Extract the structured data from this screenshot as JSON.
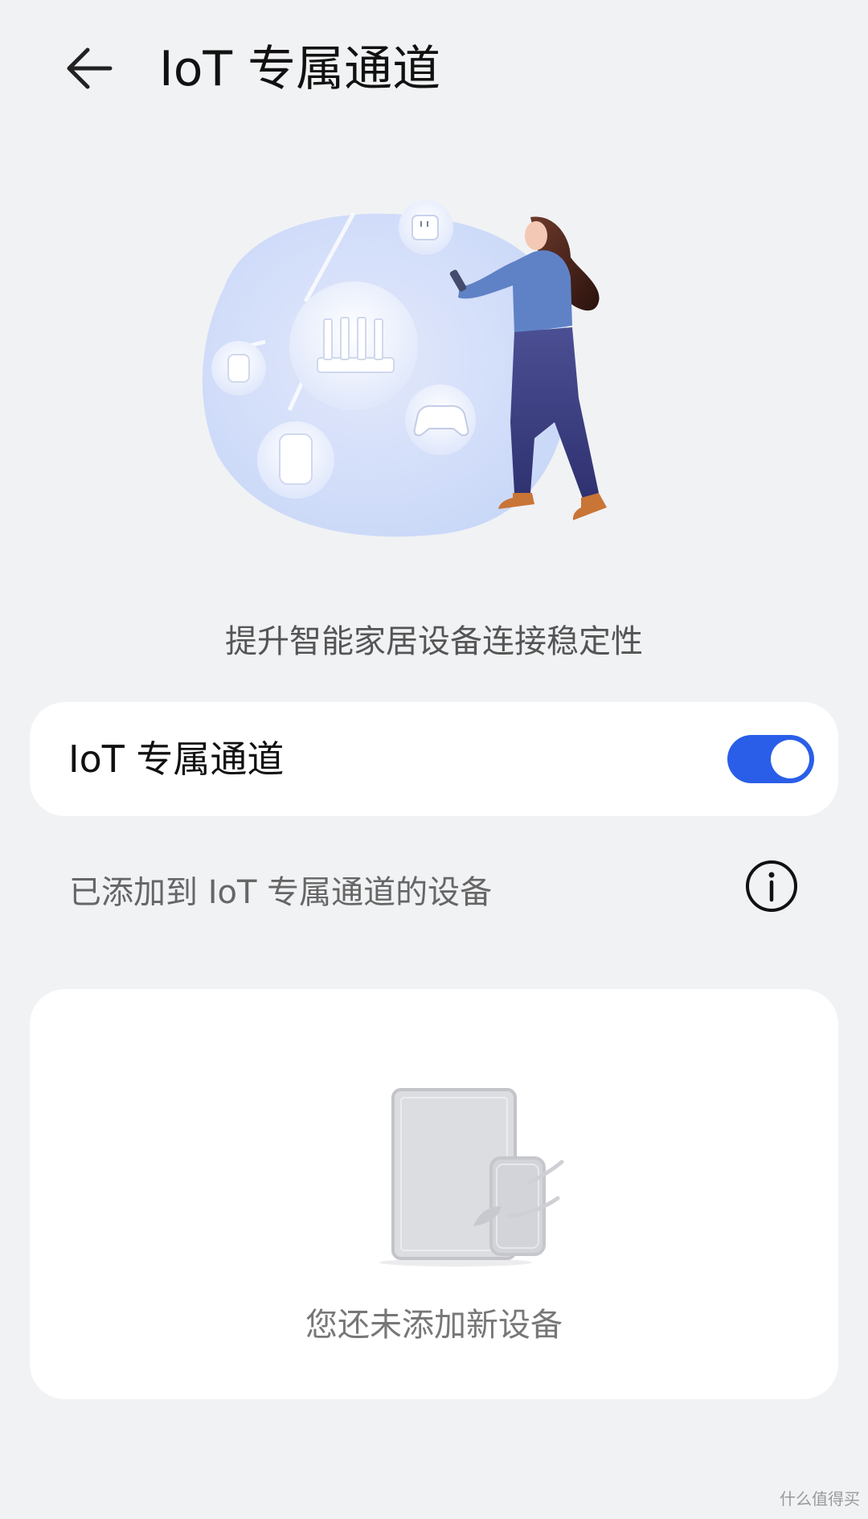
{
  "header": {
    "title": "IoT 专属通道",
    "back_icon": "arrow-left-icon"
  },
  "hero": {
    "subtitle": "提升智能家居设备连接稳定性",
    "illustration": "smart-home-network-illustration"
  },
  "toggle_card": {
    "label": "IoT 专属通道",
    "enabled": true,
    "accent_color": "#2a5ee8"
  },
  "devices_section": {
    "label": "已添加到 IoT 专属通道的设备",
    "info_icon": "info-icon",
    "empty_text": "您还未添加新设备"
  },
  "watermark": {
    "text": "什么值得买"
  }
}
